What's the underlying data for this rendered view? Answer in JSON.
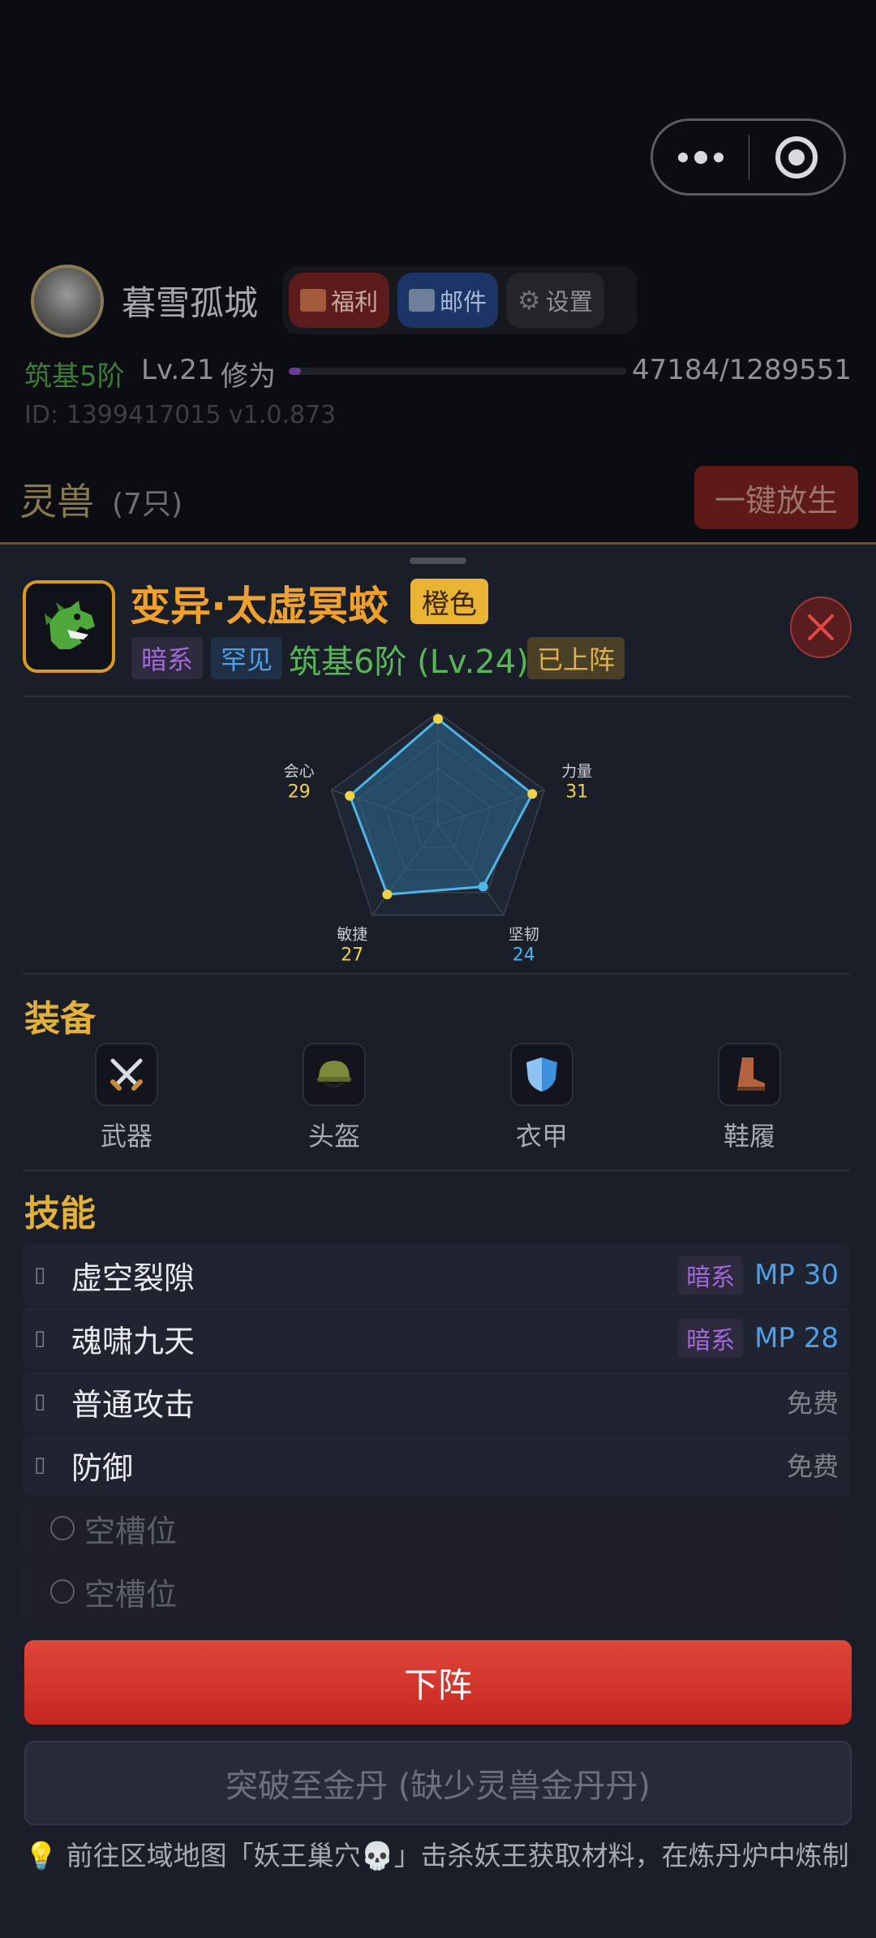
{
  "player": {
    "name": "暮雪孤城",
    "realm": "筑基5阶",
    "level": "Lv.21",
    "xp_label": "修为",
    "xp_text": "47184/1289551",
    "xp_progress": 0.0366,
    "id_version": "ID: 1399417015  v1.0.873"
  },
  "header_buttons": {
    "welfare": "福利",
    "mail": "邮件",
    "settings": "设置"
  },
  "pets_section": {
    "title": "灵兽",
    "count": "(7只)",
    "release_all": "一键放生"
  },
  "pet": {
    "name": "变异·太虚冥蛟",
    "rarity": "橙色",
    "element": "暗系",
    "grade": "罕见",
    "realm": "筑基6阶 (Lv.24)",
    "status": "已上阵"
  },
  "chart_data": {
    "type": "radar",
    "axes": [
      {
        "label": "",
        "value": null
      },
      {
        "label": "力量",
        "value": 31
      },
      {
        "label": "坚韧",
        "value": 24
      },
      {
        "label": "敏捷",
        "value": 27
      },
      {
        "label": "会心",
        "value": 29
      }
    ],
    "colors": {
      "fill": "#2d6a8f",
      "stroke": "#4fb4e8",
      "point": "#f1d34a",
      "point_alt": "#4fb4e8"
    }
  },
  "equipment": {
    "title": "装备",
    "slots": [
      {
        "label": "武器",
        "icon": "crossed-swords-icon"
      },
      {
        "label": "头盔",
        "icon": "helmet-icon"
      },
      {
        "label": "衣甲",
        "icon": "shield-icon"
      },
      {
        "label": "鞋履",
        "icon": "boot-icon"
      }
    ]
  },
  "skills": {
    "title": "技能",
    "items": [
      {
        "name": "虚空裂隙",
        "tag": "暗系",
        "cost": "MP 30"
      },
      {
        "name": "魂啸九天",
        "tag": "暗系",
        "cost": "MP 28"
      },
      {
        "name": "普通攻击",
        "cost": "免费"
      },
      {
        "name": "防御",
        "cost": "免费"
      }
    ],
    "empty_slot": "空槽位"
  },
  "actions": {
    "unequip": "下阵",
    "breakthrough": "突破至金丹 (缺少灵兽金丹丹)"
  },
  "tip": "💡 前往区域地图「妖王巢穴💀」击杀妖王获取材料，在炼丹炉中炼制",
  "theme": {
    "accent": "#e3b13a",
    "danger": "#d7352c",
    "dark_element": "#a06ad8",
    "mp": "#4f9fe6",
    "realm_green": "#58b656"
  }
}
